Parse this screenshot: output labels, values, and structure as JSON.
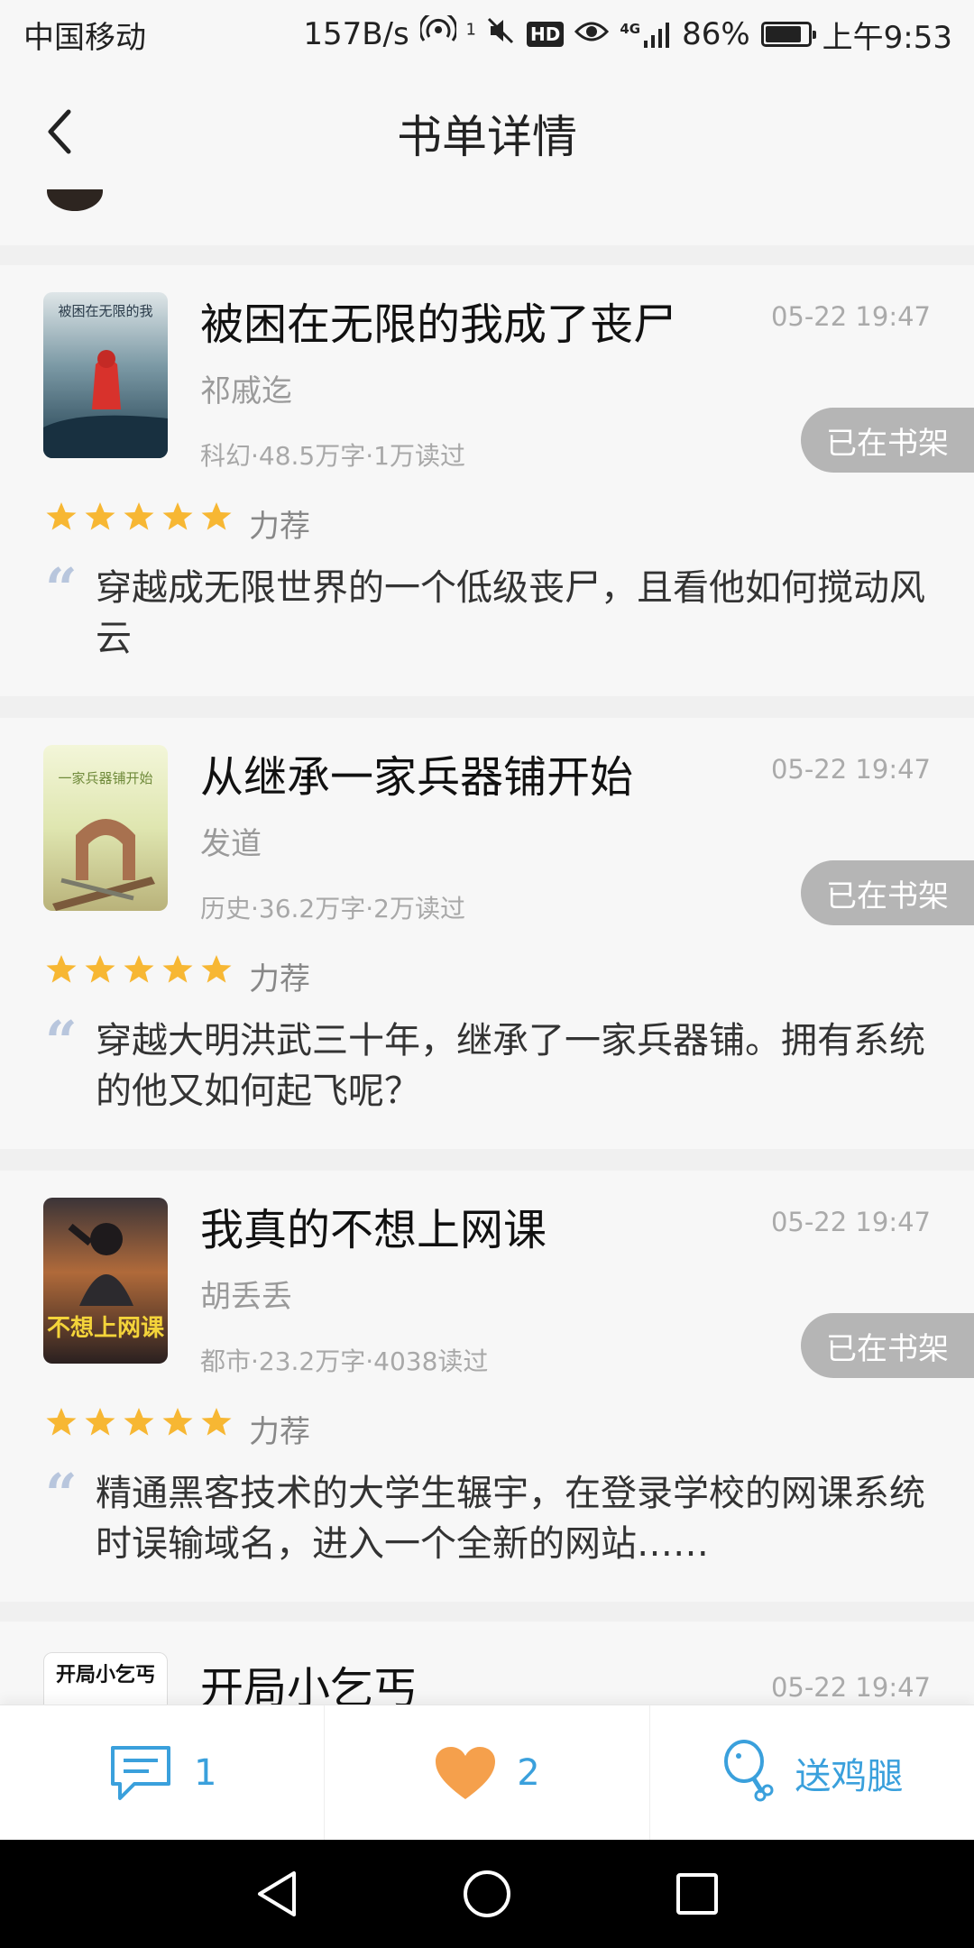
{
  "status_bar": {
    "carrier": "中国移动",
    "net_speed": "157B/s",
    "hotspot_count": "1",
    "hd_label": "HD",
    "network_label": "4G",
    "battery": "86%",
    "battery_level": 0.86,
    "time": "上午9:53"
  },
  "header": {
    "title": "书单详情"
  },
  "books": [
    {
      "title": "被困在无限的我成了丧尸",
      "time": "05-22 19:47",
      "author": "祁戚迄",
      "meta": "科幻·48.5万字·1万读过",
      "shelf_label": "已在书架",
      "rating": 5,
      "rating_label": "力荐",
      "quote": "“",
      "desc": "穿越成无限世界的一个低级丧尸，且看他如何搅动风云",
      "cover_text": "被困在无限的我"
    },
    {
      "title": "从继承一家兵器铺开始",
      "time": "05-22 19:47",
      "author": "发道",
      "meta": "历史·36.2万字·2万读过",
      "shelf_label": "已在书架",
      "rating": 5,
      "rating_label": "力荐",
      "quote": "“",
      "desc": "穿越大明洪武三十年，继承了一家兵器铺。拥有系统的他又如何起飞呢？",
      "cover_text": "一家兵器铺开始"
    },
    {
      "title": "我真的不想上网课",
      "time": "05-22 19:47",
      "author": "胡丢丢",
      "meta": "都市·23.2万字·4038读过",
      "shelf_label": "已在书架",
      "rating": 5,
      "rating_label": "力荐",
      "quote": "“",
      "desc": "精通黑客技术的大学生辗宇，在登录学校的网课系统时误输域名，进入一个全新的网站……",
      "cover_text": "不想上网课"
    },
    {
      "title": "开局小乞丐",
      "time": "05-22 19:47",
      "cover_text": "开局小乞丐"
    }
  ],
  "bottom_bar": {
    "comment_count": "1",
    "like_count": "2",
    "gift_label": "送鸡腿"
  },
  "colors": {
    "accent": "#3aa0dc",
    "star": "#f7b733",
    "heart": "#f5a04c",
    "badge": "#b5b5b5"
  },
  "icons": {
    "back": "chevron-left-icon",
    "comment": "comment-icon",
    "like": "heart-icon",
    "gift": "drumstick-icon",
    "nav_back": "triangle-back-icon",
    "nav_home": "circle-home-icon",
    "nav_recent": "square-recent-icon"
  }
}
